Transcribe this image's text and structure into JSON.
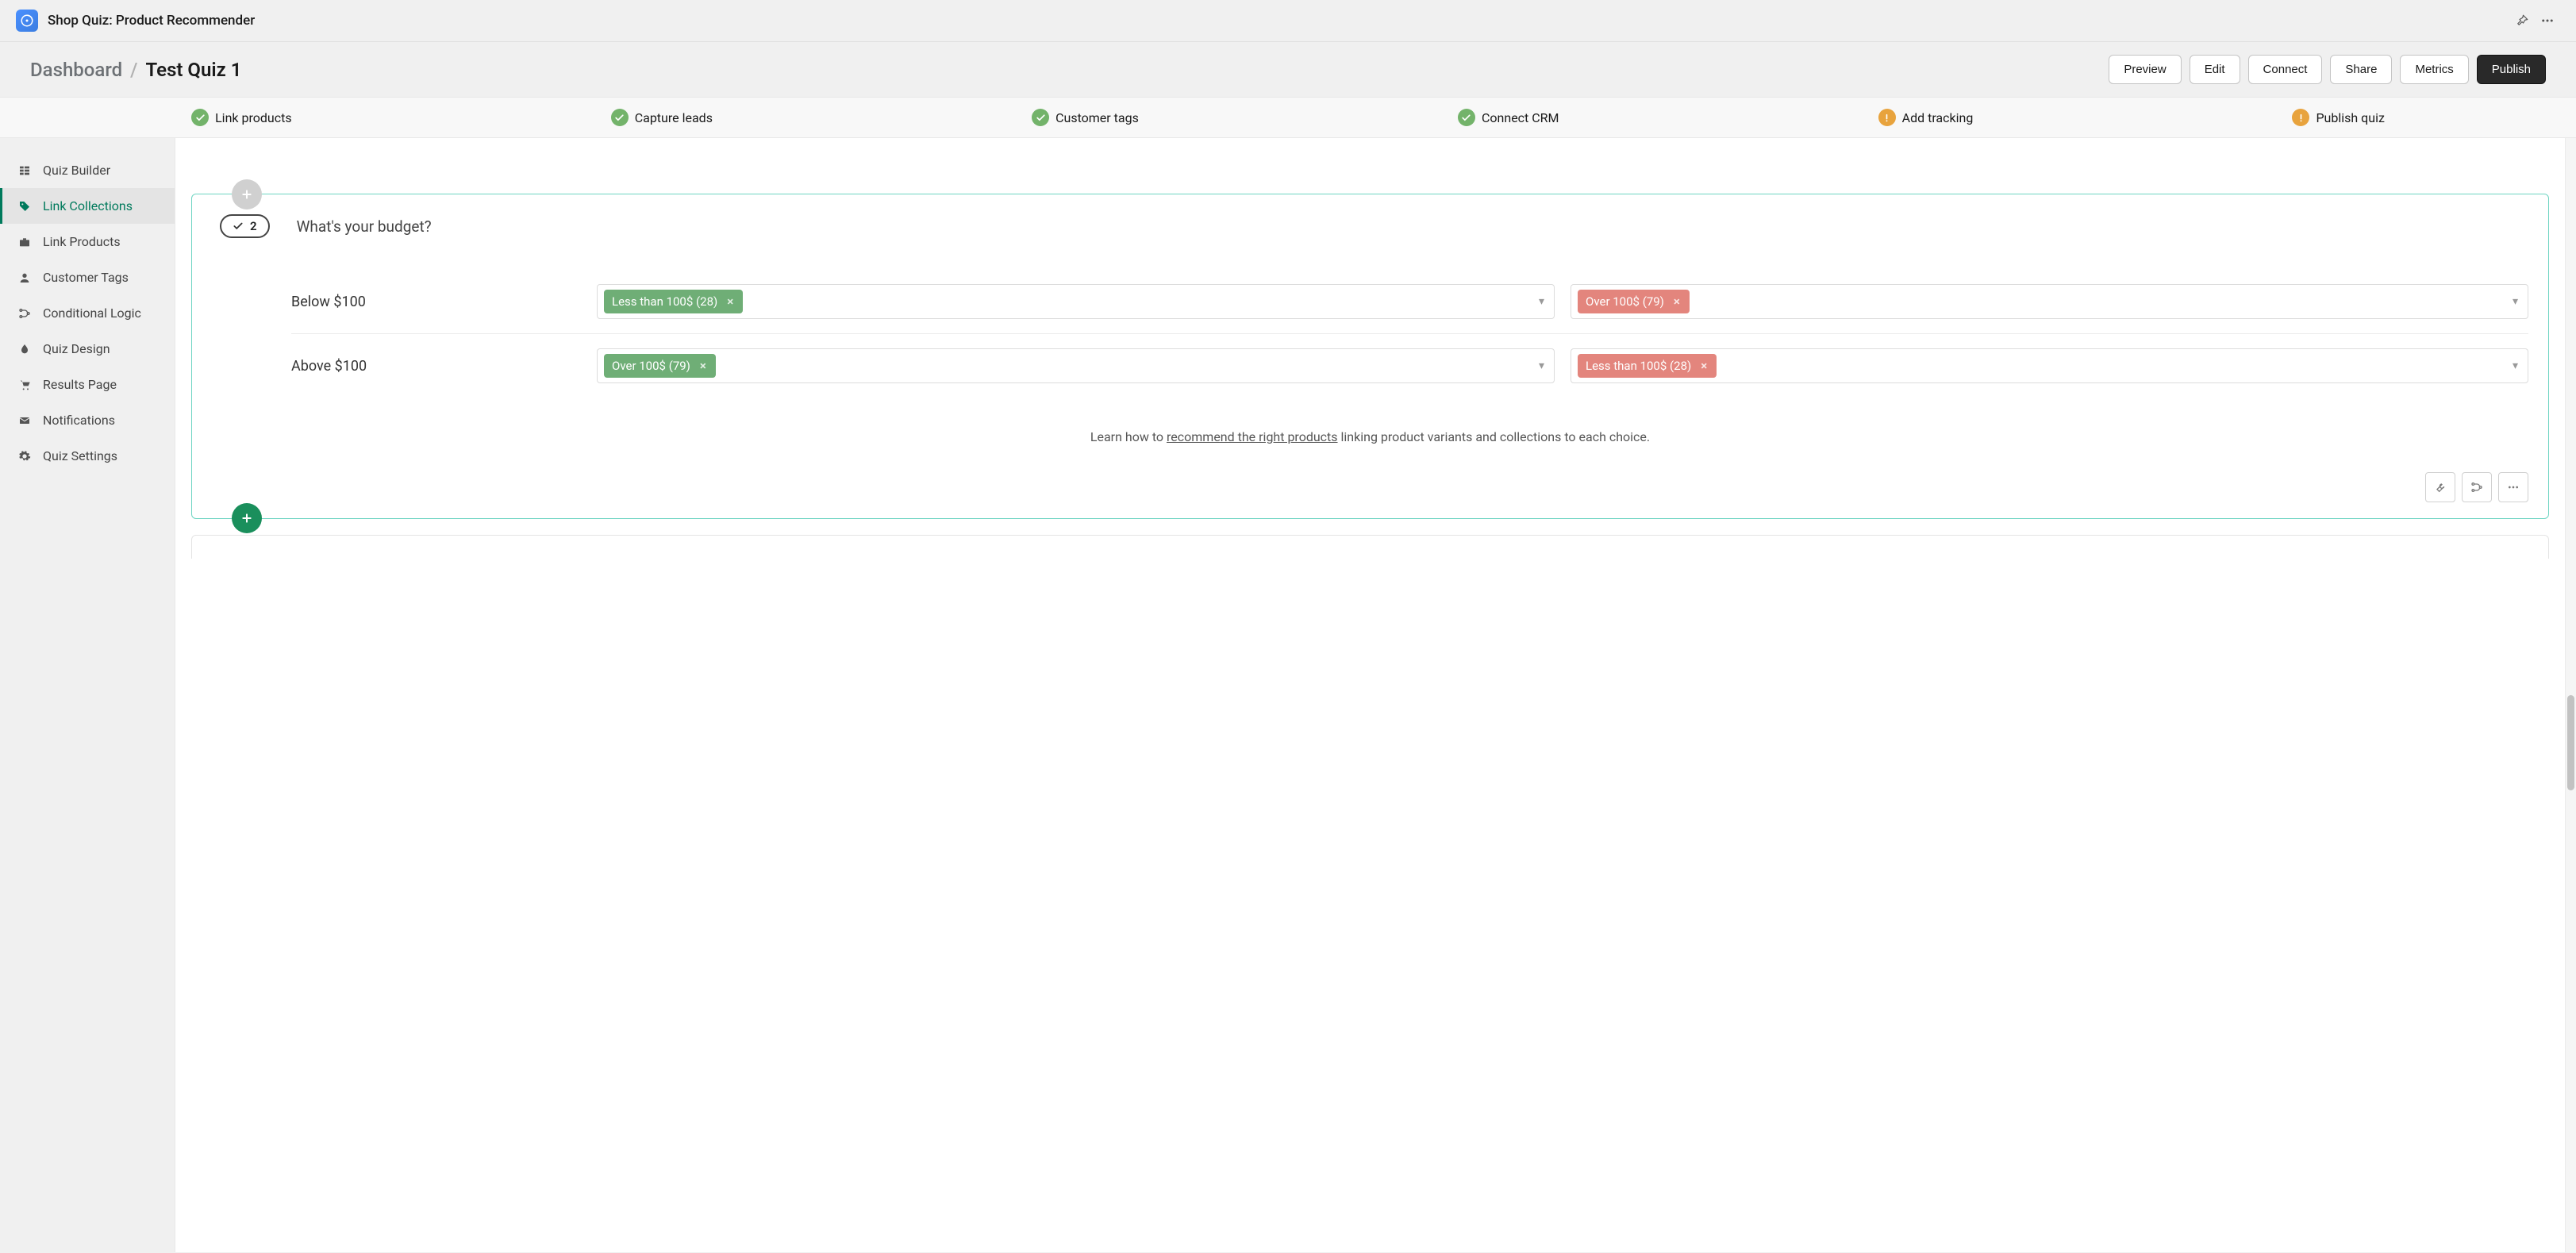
{
  "app": {
    "title": "Shop Quiz: Product Recommender"
  },
  "breadcrumb": {
    "root": "Dashboard",
    "current": "Test Quiz 1"
  },
  "header_actions": {
    "preview": "Preview",
    "edit": "Edit",
    "connect": "Connect",
    "share": "Share",
    "metrics": "Metrics",
    "publish": "Publish"
  },
  "steps": [
    {
      "label": "Link products",
      "status": "complete"
    },
    {
      "label": "Capture leads",
      "status": "complete"
    },
    {
      "label": "Customer tags",
      "status": "complete"
    },
    {
      "label": "Connect CRM",
      "status": "complete"
    },
    {
      "label": "Add tracking",
      "status": "warn"
    },
    {
      "label": "Publish quiz",
      "status": "warn"
    }
  ],
  "sidebar": {
    "items": [
      {
        "label": "Quiz Builder",
        "icon": "layout-icon"
      },
      {
        "label": "Link Collections",
        "icon": "tag-icon",
        "active": true
      },
      {
        "label": "Link Products",
        "icon": "briefcase-icon"
      },
      {
        "label": "Customer Tags",
        "icon": "user-icon"
      },
      {
        "label": "Conditional Logic",
        "icon": "branch-icon"
      },
      {
        "label": "Quiz Design",
        "icon": "drop-icon"
      },
      {
        "label": "Results Page",
        "icon": "cart-icon"
      },
      {
        "label": "Notifications",
        "icon": "mail-icon"
      },
      {
        "label": "Quiz Settings",
        "icon": "gear-icon"
      }
    ]
  },
  "question": {
    "number": "2",
    "title": "What's your budget?",
    "answers": [
      {
        "label": "Below $100",
        "include": {
          "text": "Less than 100$ (28)"
        },
        "exclude": {
          "text": "Over 100$ (79)"
        }
      },
      {
        "label": "Above $100",
        "include": {
          "text": "Over 100$ (79)"
        },
        "exclude": {
          "text": "Less than 100$ (28)"
        }
      }
    ]
  },
  "help": {
    "prefix": "Learn how to ",
    "link": "recommend the right products",
    "suffix": " linking product variants and collections to each choice."
  }
}
